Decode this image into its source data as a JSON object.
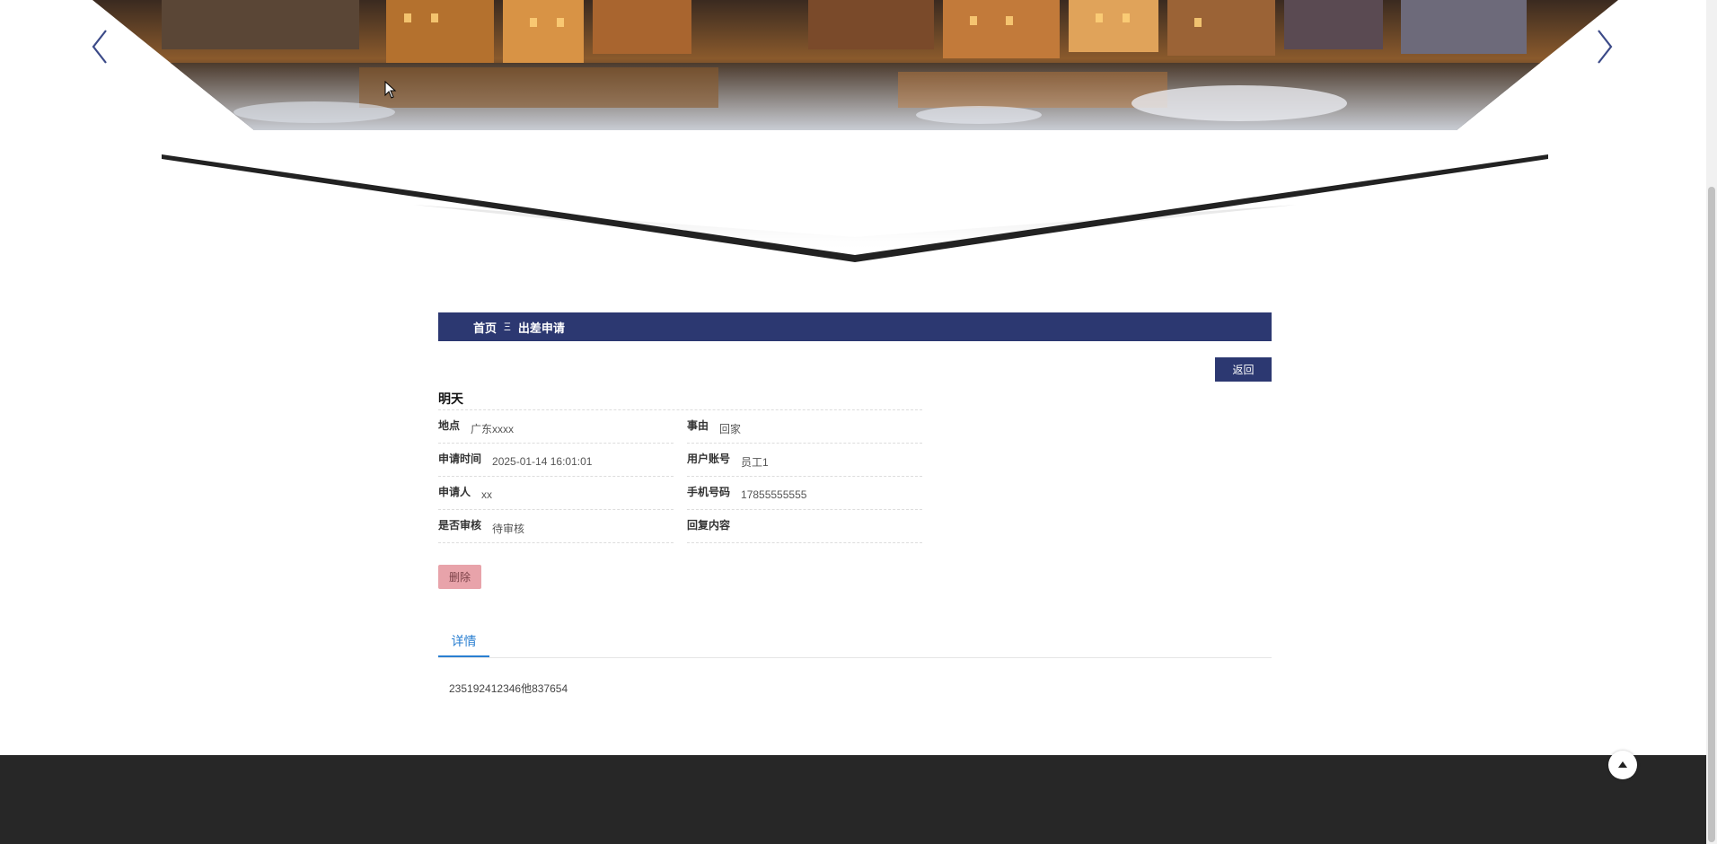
{
  "banner": {
    "image": "canal-town-night-photo",
    "prev_icon": "chevron-left-icon",
    "next_icon": "chevron-right-icon"
  },
  "breadcrumb": {
    "home_label": "首页",
    "separator": "Ξ",
    "current_label": "出差申请"
  },
  "toolbar": {
    "back_label": "返回"
  },
  "detail": {
    "title": "明天",
    "fields": [
      {
        "label": "地点",
        "value": "广东xxxx"
      },
      {
        "label": "事由",
        "value": "回家"
      },
      {
        "label": "申请时间",
        "value": "2025-01-14 16:01:01"
      },
      {
        "label": "用户账号",
        "value": "员工1"
      },
      {
        "label": "申请人",
        "value": "xx"
      },
      {
        "label": "手机号码",
        "value": "17855555555"
      },
      {
        "label": "是否审核",
        "value": "待审核"
      },
      {
        "label": "回复内容",
        "value": ""
      }
    ],
    "delete_label": "删除"
  },
  "tabs": {
    "active_label": "详情"
  },
  "detail_body": {
    "text": "235192412346他837654"
  },
  "footer": {
    "back_to_top_icon": "arrow-up-icon"
  },
  "colors": {
    "primary": "#2c3871",
    "tab_active": "#2a7fd1",
    "delete": "#e8a3aa",
    "footer": "#272727"
  }
}
